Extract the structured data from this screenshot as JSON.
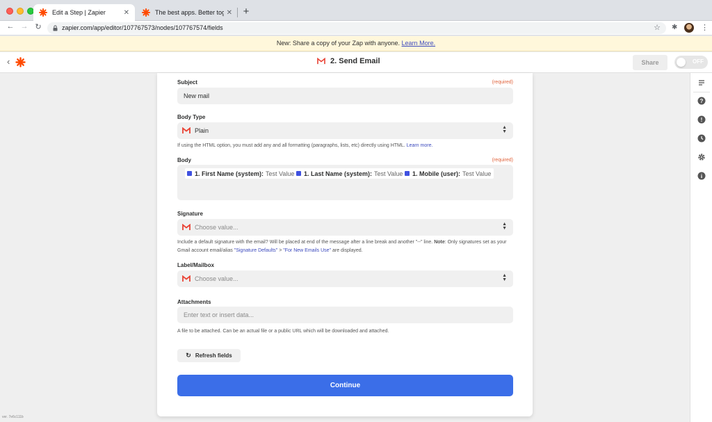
{
  "browser": {
    "tabs": [
      {
        "title": "Edit a Step | Zapier",
        "active": true
      },
      {
        "title": "The best apps. Better togethe",
        "active": false
      }
    ],
    "url": "zapier.com/app/editor/107767573/nodes/107767574/fields"
  },
  "banner": {
    "text": "New: Share a copy of your Zap with anyone.",
    "link": "Learn More."
  },
  "header": {
    "step_title": "2. Send Email",
    "share_label": "Share",
    "toggle_label": "OFF"
  },
  "form": {
    "subject": {
      "label": "Subject",
      "required": "(required)",
      "value": "New mail"
    },
    "body_type": {
      "label": "Body Type",
      "value": "Plain",
      "help": "If using the HTML option, you must add any and all formatting (paragraphs, lists, etc) directly using HTML.",
      "help_link": "Learn more."
    },
    "body": {
      "label": "Body",
      "required": "(required)",
      "pills": [
        {
          "key": "1. First Name (system):",
          "value": "Test Value"
        },
        {
          "key": "1. Last Name (system):",
          "value": "Test Value"
        },
        {
          "key": "1. Mobile (user):",
          "value": "Test Value"
        }
      ]
    },
    "signature": {
      "label": "Signature",
      "placeholder": "Choose value...",
      "help_a": "Include a default signature with the email? Will be placed at end of the message after a line break and another \"--\" line.",
      "help_note": "Note",
      "help_b": ": Only signatures set as your Gmail account email/alias",
      "help_link1": "\"Signature Defaults\"",
      "help_gt": ">",
      "help_link2": "\"For New Emails Use\"",
      "help_c": "are displayed."
    },
    "label_mailbox": {
      "label": "Label/Mailbox",
      "placeholder": "Choose value..."
    },
    "attachments": {
      "label": "Attachments",
      "placeholder": "Enter text or insert data...",
      "help": "A file to be attached. Can be an actual file or a public URL which will be downloaded and attached."
    },
    "refresh_label": "Refresh fields",
    "continue_label": "Continue"
  },
  "footer": {
    "version": "ver. 7e6c111b"
  },
  "colors": {
    "accent": "#3b6ee8",
    "zapier_orange": "#ff4a00",
    "required": "#e0623a",
    "banner_bg": "#fff7db"
  },
  "icons": {
    "tab1": "zapier-logo-icon",
    "tab2": "zapier-logo-icon",
    "app": "gmail-icon",
    "pill": "token-icon",
    "sidebar": [
      "details-icon",
      "help-icon",
      "alert-icon",
      "history-icon",
      "settings-icon",
      "info-icon"
    ]
  }
}
